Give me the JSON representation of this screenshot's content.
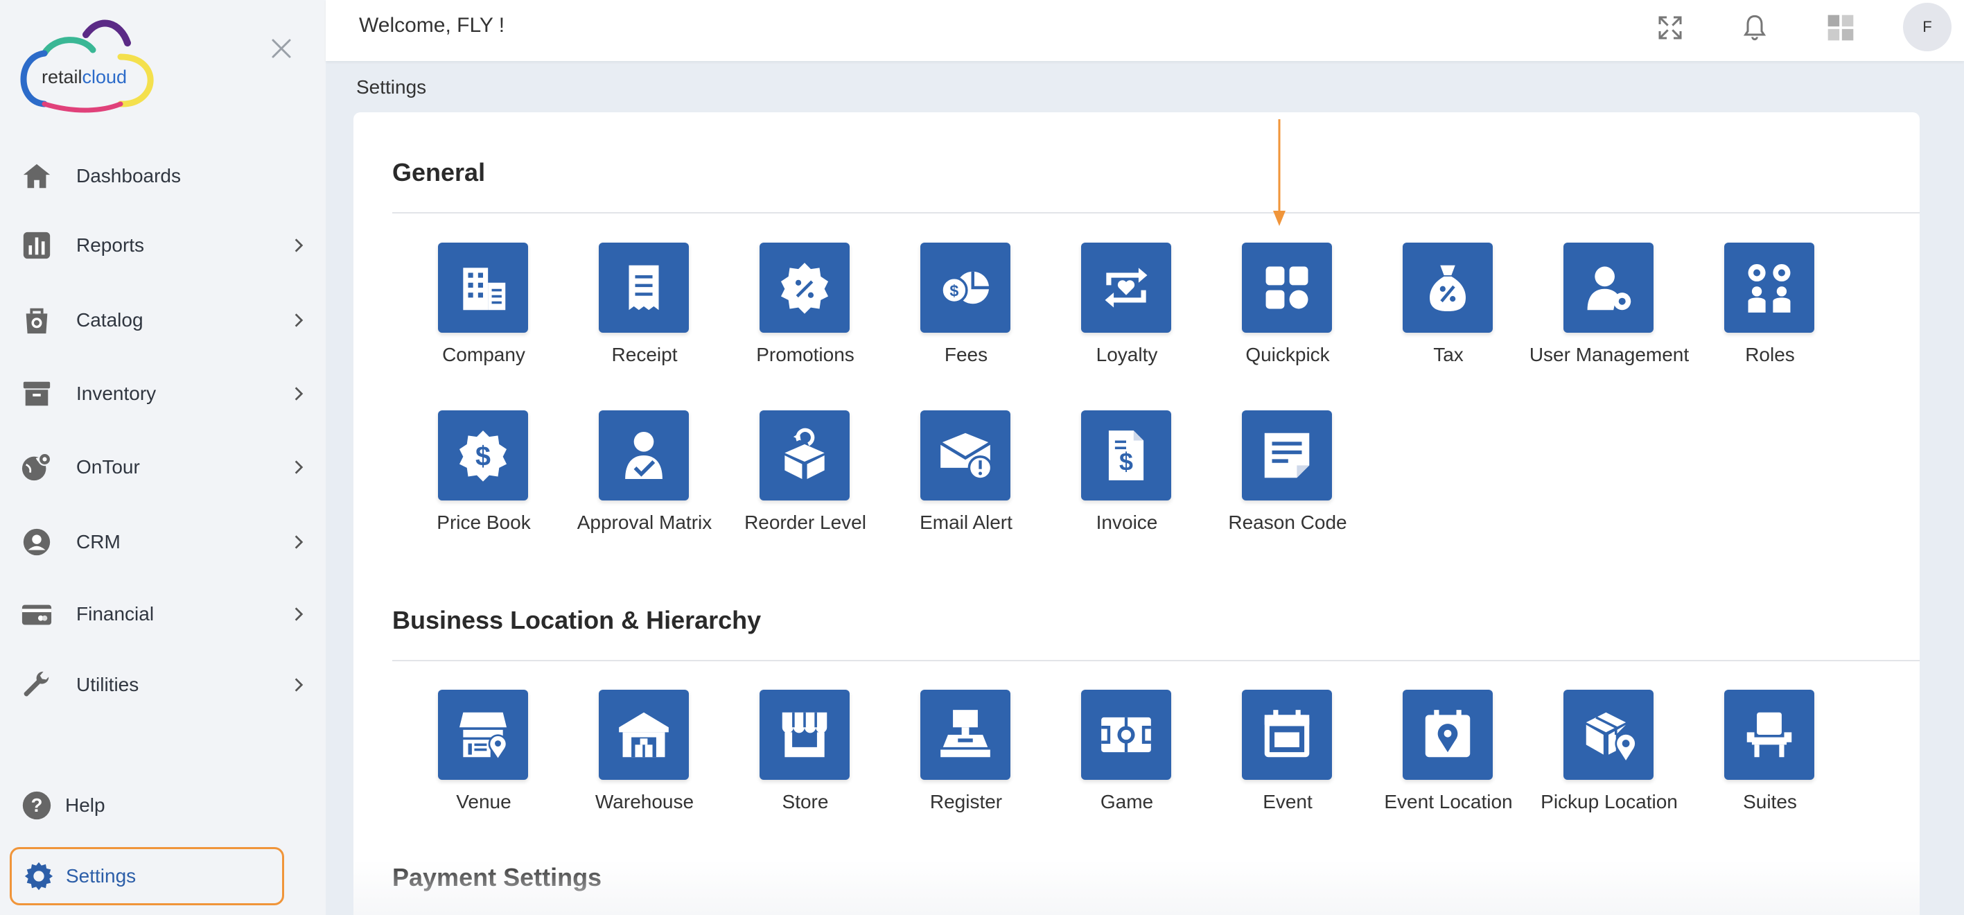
{
  "brand": {
    "logo_text_a": "retail",
    "logo_text_b": "cloud"
  },
  "sidebar": {
    "items": [
      {
        "label": "Dashboards",
        "icon": "home-icon"
      },
      {
        "label": "Reports",
        "icon": "bar-chart-icon"
      },
      {
        "label": "Catalog",
        "icon": "bag-icon"
      },
      {
        "label": "Inventory",
        "icon": "archive-box-icon"
      },
      {
        "label": "OnTour",
        "icon": "globe-pin-icon"
      },
      {
        "label": "CRM",
        "icon": "person-gear-icon"
      },
      {
        "label": "Financial",
        "icon": "credit-card-icon"
      },
      {
        "label": "Utilities",
        "icon": "wrench-icon"
      }
    ],
    "help_label": "Help",
    "settings_label": "Settings"
  },
  "header": {
    "welcome": "Welcome, FLY !",
    "avatar_initial": "F"
  },
  "breadcrumb": "Settings",
  "sections": {
    "general": {
      "title": "General",
      "tiles": [
        "Company",
        "Receipt",
        "Promotions",
        "Fees",
        "Loyalty",
        "Quickpick",
        "Tax",
        "User Management",
        "Roles",
        "Price Book",
        "Approval Matrix",
        "Reorder Level",
        "Email Alert",
        "Invoice",
        "Reason Code"
      ]
    },
    "business": {
      "title": "Business Location & Hierarchy",
      "tiles": [
        "Venue",
        "Warehouse",
        "Store",
        "Register",
        "Game",
        "Event",
        "Event Location",
        "Pickup Location",
        "Suites"
      ]
    },
    "payment": {
      "title": "Payment Settings"
    }
  },
  "colors": {
    "tile_blue": "#2f63ad",
    "highlight_orange": "#f0953a",
    "settings_blue": "#2c5ea8"
  }
}
